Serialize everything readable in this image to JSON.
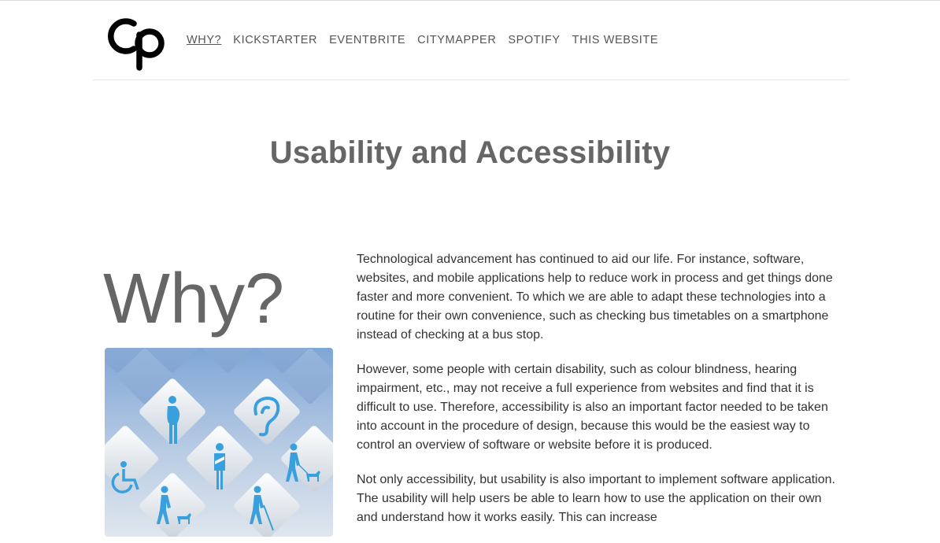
{
  "logo": {
    "text": "Cp"
  },
  "nav": {
    "items": [
      {
        "label": "WHY?",
        "active": true
      },
      {
        "label": "KICKSTARTER",
        "active": false
      },
      {
        "label": "EVENTBRITE",
        "active": false
      },
      {
        "label": "CITYMAPPER",
        "active": false
      },
      {
        "label": "SPOTIFY",
        "active": false
      },
      {
        "label": "THIS WEBSITE",
        "active": false
      }
    ]
  },
  "page": {
    "title": "Usability and Accessibility",
    "section_heading": "Why?",
    "paragraphs": [
      "Technological advancement has continued to aid our life. For instance, software, websites, and mobile applications help to reduce work in process and get things done faster and more convenient. To which we are able to adapt these technologies into a routine for their own convenience, such as checking bus timetables on a smartphone instead of checking at a bus stop.",
      "However, some people with certain disability, such as colour blindness, hearing impairment, etc., may not receive a full experience from websites and find that it is difficult to use. Therefore, accessibility is also an important factor needed to be taken into account in the procedure of design, because this would be the easiest way to control an overview of software or website before it is produced.",
      "Not only accessibility, but usability is also important to implement software application. The usability will help users be able to learn how to use the application on their own and understand how it works easily. This can increase"
    ]
  },
  "hero_image": {
    "icons": [
      "wheelchair-icon",
      "pregnant-person-icon",
      "ear-icon",
      "injured-arm-icon",
      "guide-dog-icon",
      "blind-person-icon",
      "cane-user-icon"
    ]
  },
  "colors": {
    "title": "#666666",
    "body_text": "#333333",
    "nav_text": "#555555",
    "icon_blue": "#3aa0dd"
  }
}
